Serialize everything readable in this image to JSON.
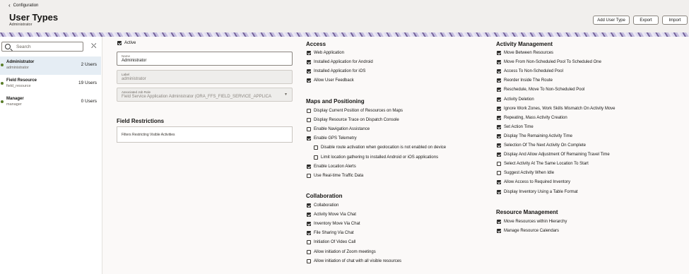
{
  "header": {
    "breadcrumb": "Configuration",
    "title": "User Types",
    "subtitle": "Administrator",
    "buttons": [
      "Add User Type",
      "Export",
      "Import"
    ]
  },
  "sidebar": {
    "search_placeholder": "Search",
    "items": [
      {
        "name": "Administrator",
        "sub": "administrator",
        "count": "2 Users"
      },
      {
        "name": "Field Resource",
        "sub": "field_resource",
        "count": "19 Users"
      },
      {
        "name": "Manager",
        "sub": "manager",
        "count": "0 Users"
      }
    ]
  },
  "form": {
    "active_label": "Active",
    "active_checked": true,
    "name_label": "Name",
    "name_value": "Administrator",
    "label_label": "Label",
    "label_value": "administrator",
    "role_label": "Associated Job Role",
    "role_value": "Field Service Application Administrator (ORA_FFS_FIELD_SERVICE_APPLICA",
    "field_restrictions_title": "Field Restrictions",
    "field_restrictions_value": "Filters Restricting Visible Activities"
  },
  "access": {
    "title": "Access",
    "items": [
      {
        "label": "Web Application",
        "checked": true
      },
      {
        "label": "Installed Application for Android",
        "checked": true
      },
      {
        "label": "Installed Application for iOS",
        "checked": true
      },
      {
        "label": "Allow User Feedback",
        "checked": true
      }
    ]
  },
  "maps": {
    "title": "Maps and Positioning",
    "items": [
      {
        "label": "Display Current Position of Resources on Maps",
        "checked": false,
        "indent": false
      },
      {
        "label": "Display Resource Trace on Dispatch Console",
        "checked": false,
        "indent": false
      },
      {
        "label": "Enable Navigation Assistance",
        "checked": false,
        "indent": false
      },
      {
        "label": "Enable GPS Telemetry",
        "checked": true,
        "indent": false
      },
      {
        "label": "Disable route activation when geolocation is not enabled on device",
        "checked": false,
        "indent": true
      },
      {
        "label": "Limit location gathering to installed Android or iOS applications",
        "checked": false,
        "indent": true
      },
      {
        "label": "Enable Location Alerts",
        "checked": true,
        "indent": false
      },
      {
        "label": "Use Real-time Traffic Data",
        "checked": false,
        "indent": false
      }
    ]
  },
  "collaboration": {
    "title": "Collaboration",
    "items": [
      {
        "label": "Collaboration",
        "checked": true
      },
      {
        "label": "Activity Move Via Chat",
        "checked": true
      },
      {
        "label": "Inventory Move Via Chat",
        "checked": true
      },
      {
        "label": "File Sharing Via Chat",
        "checked": true
      },
      {
        "label": "Initiation Of Video Call",
        "checked": false
      },
      {
        "label": "Allow initiation of Zoom meetings",
        "checked": false
      },
      {
        "label": "Allow initiation of chat with all visible resources",
        "checked": false
      }
    ]
  },
  "activity": {
    "title": "Activity Management",
    "items": [
      {
        "label": "Move Between Resources",
        "checked": true
      },
      {
        "label": "Move From Non-Scheduled Pool To Scheduled One",
        "checked": true
      },
      {
        "label": "Access To Non-Scheduled Pool",
        "checked": true
      },
      {
        "label": "Reorder Inside The Route",
        "checked": true
      },
      {
        "label": "Reschedule, Move To Non-Scheduled Pool",
        "checked": true
      },
      {
        "label": "Activity Deletion",
        "checked": true
      },
      {
        "label": "Ignore Work Zones, Work Skills Mismatch On Activity Move",
        "checked": true
      },
      {
        "label": "Repeating, Mass Activity Creation",
        "checked": true
      },
      {
        "label": "Set Action Time",
        "checked": true
      },
      {
        "label": "Display The Remaining Activity Time",
        "checked": true
      },
      {
        "label": "Selection Of The Next Activity On Complete",
        "checked": true
      },
      {
        "label": "Display And Allow Adjustment Of Remaining Travel Time",
        "checked": true
      },
      {
        "label": "Select Activity At The Same Location To Start",
        "checked": false
      },
      {
        "label": "Suggest Activity When Idle",
        "checked": false
      },
      {
        "label": "Allow Access to Required Inventory",
        "checked": true
      },
      {
        "label": "Display Inventory Using a Table Format",
        "checked": true
      }
    ]
  },
  "resource": {
    "title": "Resource Management",
    "items": [
      {
        "label": "Move Resources within Hierarchy",
        "checked": true
      },
      {
        "label": "Manage Resource Calendars",
        "checked": true
      }
    ]
  }
}
